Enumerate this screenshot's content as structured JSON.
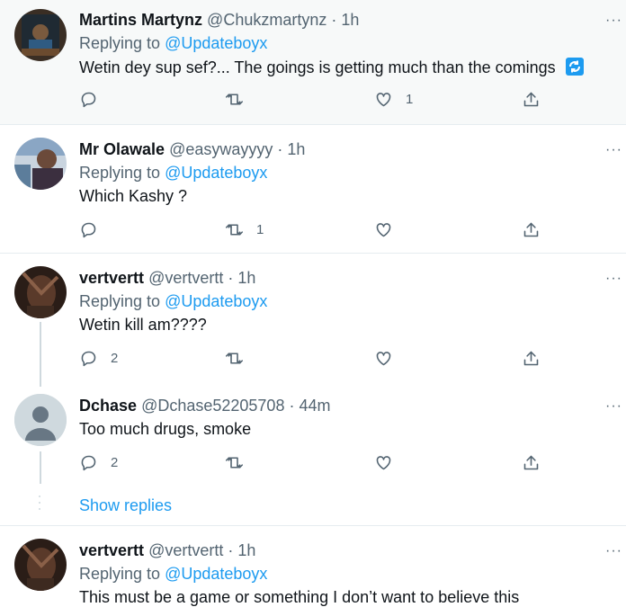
{
  "tweets": [
    {
      "name": "Martins Martynz",
      "handle": "@Chukzmartynz",
      "time": "· 1h",
      "replying_prefix": "Replying to ",
      "replying_to": "@Updateboyx",
      "text": "Wetin dey sup sef?... The goings is getting much than the comings",
      "badge": "recycle-emoji-icon",
      "replies": "",
      "retweets": "",
      "likes": "1",
      "bg": "#f7f9f9"
    },
    {
      "name": "Mr Olawale",
      "handle": "@easywayyyy",
      "time": "· 1h",
      "replying_prefix": "Replying to ",
      "replying_to": "@Updateboyx",
      "text": "Which Kashy ?",
      "replies": "",
      "retweets": "1",
      "likes": ""
    },
    {
      "name": "vertvertt",
      "handle": "@vertvertt",
      "time": "· 1h",
      "replying_prefix": "Replying to ",
      "replying_to": "@Updateboyx",
      "text": "Wetin kill am????",
      "replies": "2",
      "retweets": "",
      "likes": ""
    },
    {
      "name": "Dchase",
      "handle": "@Dchase52205708",
      "time": "· 44m",
      "text": "Too much drugs, smoke",
      "replies": "2",
      "retweets": "",
      "likes": ""
    },
    {
      "name": "vertvertt",
      "handle": "@vertvertt",
      "time": "· 1h",
      "replying_prefix": "Replying to ",
      "replying_to": "@Updateboyx",
      "text": "This must be a game or something I don’t want to believe this"
    }
  ],
  "show_replies": "Show replies",
  "more_glyph": "···",
  "colors": {
    "accent": "#1d9bf0",
    "muted": "#536471",
    "divider": "#e6ecf0"
  }
}
